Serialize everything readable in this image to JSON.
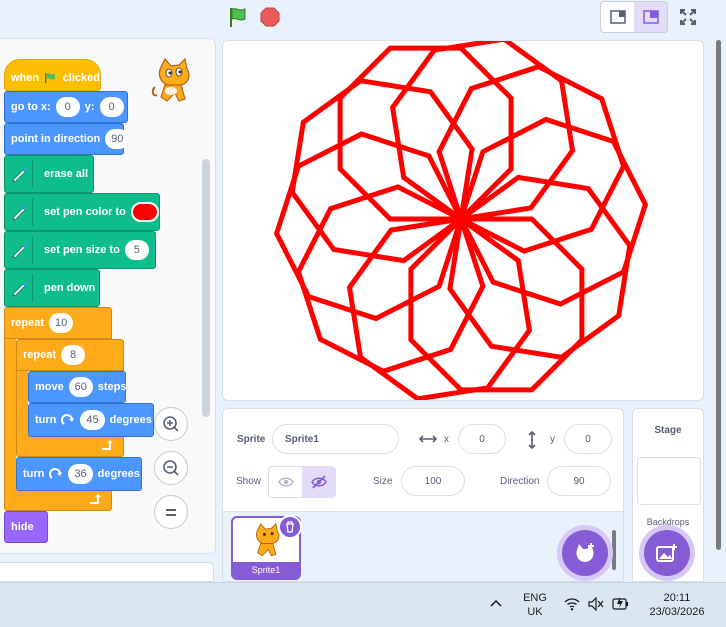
{
  "toolbar": {
    "flag_icon": "green-flag-icon",
    "stop_icon": "stop-icon",
    "layout_modes": [
      "small-stage-icon",
      "normal-stage-icon"
    ],
    "fullscreen_icon": "fullscreen-icon"
  },
  "code": {
    "hat": {
      "when": "when",
      "clicked": "clicked"
    },
    "goto": {
      "label": "go to x:",
      "x": "0",
      "y_label": "y:",
      "y": "0"
    },
    "point": {
      "label": "point in direction",
      "value": "90"
    },
    "erase": {
      "label": "erase all"
    },
    "set_color": {
      "label": "set pen color to",
      "color": "#ff0000"
    },
    "set_size": {
      "label": "set pen size to",
      "value": "5"
    },
    "pen_down": {
      "label": "pen down"
    },
    "repeat_outer": {
      "label": "repeat",
      "value": "10"
    },
    "repeat_inner": {
      "label": "repeat",
      "value": "8"
    },
    "move": {
      "label": "move",
      "value": "60",
      "unit": "steps"
    },
    "turn_inner": {
      "label": "turn",
      "value": "45",
      "unit": "degrees"
    },
    "turn_outer": {
      "label": "turn",
      "value": "36",
      "unit": "degrees"
    },
    "hide": {
      "label": "hide"
    }
  },
  "zoom": {
    "in_icon": "zoom-in-icon",
    "out_icon": "zoom-out-icon",
    "reset_icon": "zoom-reset-icon"
  },
  "sprite_info": {
    "sprite_label": "Sprite",
    "sprite_name": "Sprite1",
    "x_label": "x",
    "x": "0",
    "y_label": "y",
    "y": "0",
    "show_label": "Show",
    "size_label": "Size",
    "size": "100",
    "direction_label": "Direction",
    "direction": "90"
  },
  "sprites": [
    {
      "name": "Sprite1"
    }
  ],
  "stage_pane": {
    "title": "Stage",
    "backdrops_label": "Backdrops"
  },
  "drawing": {
    "color": "#ff0000",
    "repeats": 10,
    "sides": 8,
    "step": 60,
    "turn": 45,
    "rotate": 36
  },
  "taskbar": {
    "lang_line1": "ENG",
    "lang_line2": "UK",
    "time": "20:11",
    "date": "23/03/2026"
  }
}
